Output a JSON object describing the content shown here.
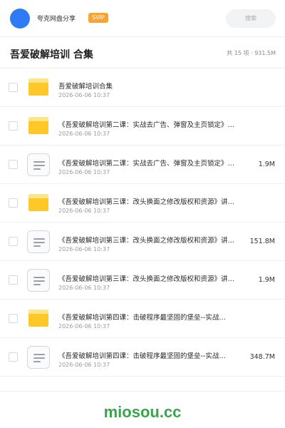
{
  "header": {
    "share_name": "夸克网盘分享",
    "badge": "SVIP",
    "search_placeholder": "搜索"
  },
  "collection": {
    "title": "吾爱破解培训 合集",
    "summary": "共 15 项 · 931.5M"
  },
  "files": [
    {
      "type": "folder",
      "name": "吾爱破解培训合集",
      "date": "2026-06-06 10:37",
      "size": ""
    },
    {
      "type": "folder",
      "name": "《吾爱破解培训第二课：实战去广告、弹窗及主页锁定》…",
      "date": "2026-06-06 10:37",
      "size": ""
    },
    {
      "type": "document",
      "name": "《吾爱破解培训第二课：实战去广告、弹窗及主页锁定》…",
      "date": "2026-06-06 10:37",
      "size": "1.9M"
    },
    {
      "type": "folder",
      "name": "《吾爱破解培训第三课：改头换面之修改版权和资源》讲…",
      "date": "2026-06-06 10:37",
      "size": ""
    },
    {
      "type": "document",
      "name": "《吾爱破解培训第三课：改头换面之修改版权和资源》讲…",
      "date": "2026-06-06 10:37",
      "size": "151.8M"
    },
    {
      "type": "document",
      "name": "《吾爱破解培训第三课：改头换面之修改版权和资源》讲…",
      "date": "2026-06-06 10:37",
      "size": "1.9M"
    },
    {
      "type": "folder",
      "name": "《吾爱破解培训第四课：击破程序最坚固的堡垒--实战…",
      "date": "2026-06-06 10:37",
      "size": ""
    },
    {
      "type": "document",
      "name": "《吾爱破解培训第四课：击破程序最坚固的堡垒--实战…",
      "date": "2026-06-06 10:37",
      "size": "348.7M"
    }
  ],
  "footer": {
    "watermark": "miosou.cc"
  }
}
